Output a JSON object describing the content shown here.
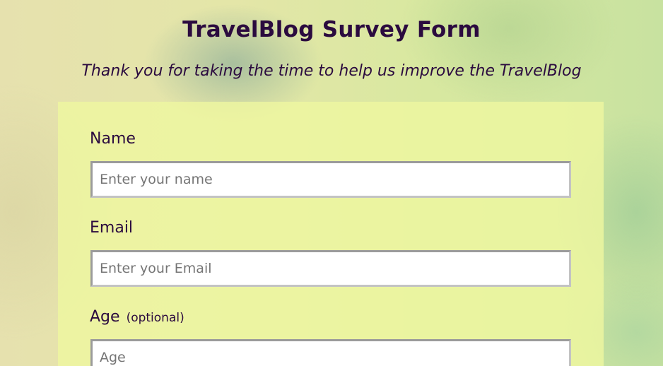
{
  "header": {
    "title": "TravelBlog Survey Form",
    "description": "Thank you for taking the time to help us improve the TravelBlog"
  },
  "form": {
    "name": {
      "label": "Name",
      "placeholder": "Enter your name",
      "value": ""
    },
    "email": {
      "label": "Email",
      "placeholder": "Enter your Email",
      "value": ""
    },
    "age": {
      "label": "Age",
      "optional_note": "(optional)",
      "placeholder": "Age",
      "value": ""
    }
  },
  "colors": {
    "text": "#2b0b3f",
    "panel": "#eef6a0",
    "input_border": "#c3c3c3"
  }
}
